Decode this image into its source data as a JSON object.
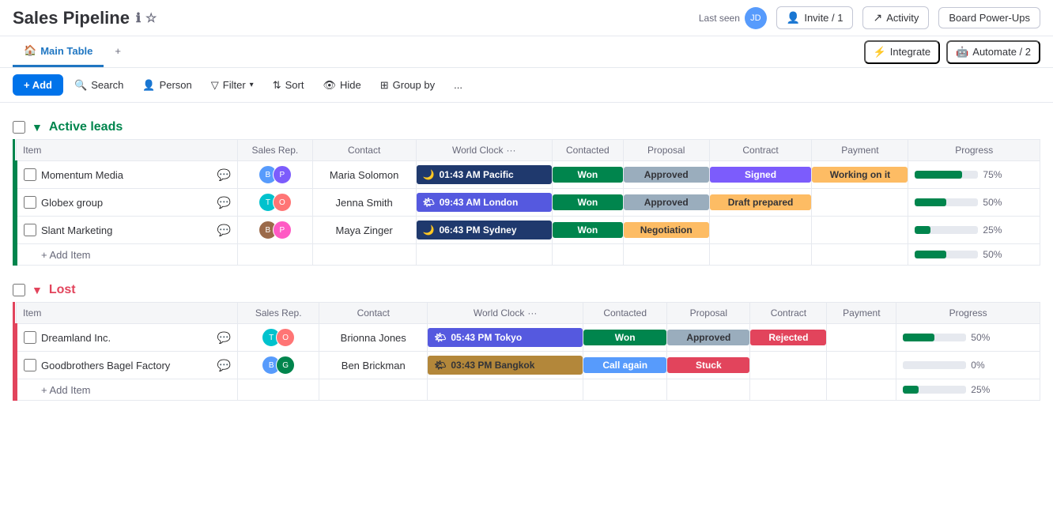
{
  "header": {
    "title": "Sales Pipeline",
    "last_seen_label": "Last seen",
    "invite_label": "Invite / 1",
    "activity_label": "Activity",
    "board_powerups_label": "Board Power-Ups",
    "integrate_label": "Integrate",
    "automate_label": "Automate / 2"
  },
  "tabs": {
    "main_table": "Main Table",
    "add_tab": "+"
  },
  "toolbar": {
    "add": "+ Add",
    "search": "Search",
    "person": "Person",
    "filter": "Filter",
    "sort": "Sort",
    "hide": "Hide",
    "group_by": "Group by",
    "more": "..."
  },
  "groups": [
    {
      "id": "active-leads",
      "title": "Active leads",
      "color": "green",
      "columns": [
        "Item",
        "Sales Rep.",
        "Contact",
        "World Clock",
        "Contacted",
        "Proposal",
        "Contract",
        "Payment",
        "Progress"
      ],
      "rows": [
        {
          "item": "Momentum Media",
          "sales_rep_avatars": [
            "blue",
            "purple"
          ],
          "contact": "Maria Solomon",
          "clock_icon": "🌙",
          "clock_time": "01:43 AM",
          "clock_zone": "Pacific",
          "clock_style": "dark-blue",
          "contacted": "Won",
          "contacted_style": "won",
          "proposal": "Approved",
          "proposal_style": "approved",
          "contract": "Signed",
          "contract_style": "signed",
          "payment": "Working on it",
          "payment_style": "working",
          "progress": 75
        },
        {
          "item": "Globex group",
          "sales_rep_avatars": [
            "teal",
            "orange"
          ],
          "contact": "Jenna Smith",
          "clock_icon": "🌤",
          "clock_time": "09:43 AM",
          "clock_zone": "London",
          "clock_style": "yellow-green",
          "contacted": "Won",
          "contacted_style": "won",
          "proposal": "Approved",
          "proposal_style": "approved",
          "contract": "Draft prepared",
          "contract_style": "draft",
          "payment": "",
          "payment_style": "",
          "progress": 50
        },
        {
          "item": "Slant Marketing",
          "sales_rep_avatars": [
            "brown",
            "pink"
          ],
          "contact": "Maya Zinger",
          "clock_icon": "🌙",
          "clock_time": "06:43 PM",
          "clock_zone": "Sydney",
          "clock_style": "dark-navy",
          "contacted": "Won",
          "contacted_style": "won",
          "proposal": "Negotiation",
          "proposal_style": "negotiation",
          "contract": "",
          "contract_style": "",
          "payment": "",
          "payment_style": "",
          "progress": 25
        }
      ],
      "add_item": "+ Add Item",
      "add_progress": 50
    },
    {
      "id": "lost",
      "title": "Lost",
      "color": "red",
      "columns": [
        "Item",
        "Sales Rep.",
        "Contact",
        "World Clock",
        "Contacted",
        "Proposal",
        "Contract",
        "Payment",
        "Progress"
      ],
      "rows": [
        {
          "item": "Dreamland Inc.",
          "sales_rep_avatars": [
            "teal",
            "orange"
          ],
          "contact": "Brionna Jones",
          "clock_icon": "🌤",
          "clock_time": "05:43 PM",
          "clock_zone": "Tokyo",
          "clock_style": "tokyo",
          "contacted": "Won",
          "contacted_style": "won",
          "proposal": "Approved",
          "proposal_style": "approved",
          "contract": "Rejected",
          "contract_style": "rejected",
          "payment": "",
          "payment_style": "",
          "progress": 50
        },
        {
          "item": "Goodbrothers Bagel Factory",
          "sales_rep_avatars": [
            "blue",
            "green"
          ],
          "contact": "Ben Brickman",
          "clock_icon": "🌤",
          "clock_time": "03:43 PM",
          "clock_zone": "Bangkok",
          "clock_style": "bangkok",
          "contacted": "Call again",
          "contacted_style": "call-again",
          "proposal": "Stuck",
          "proposal_style": "stuck",
          "contract": "",
          "contract_style": "",
          "payment": "",
          "payment_style": "",
          "progress": 0
        }
      ],
      "add_item": "+ Add Item",
      "add_progress": 25
    }
  ]
}
